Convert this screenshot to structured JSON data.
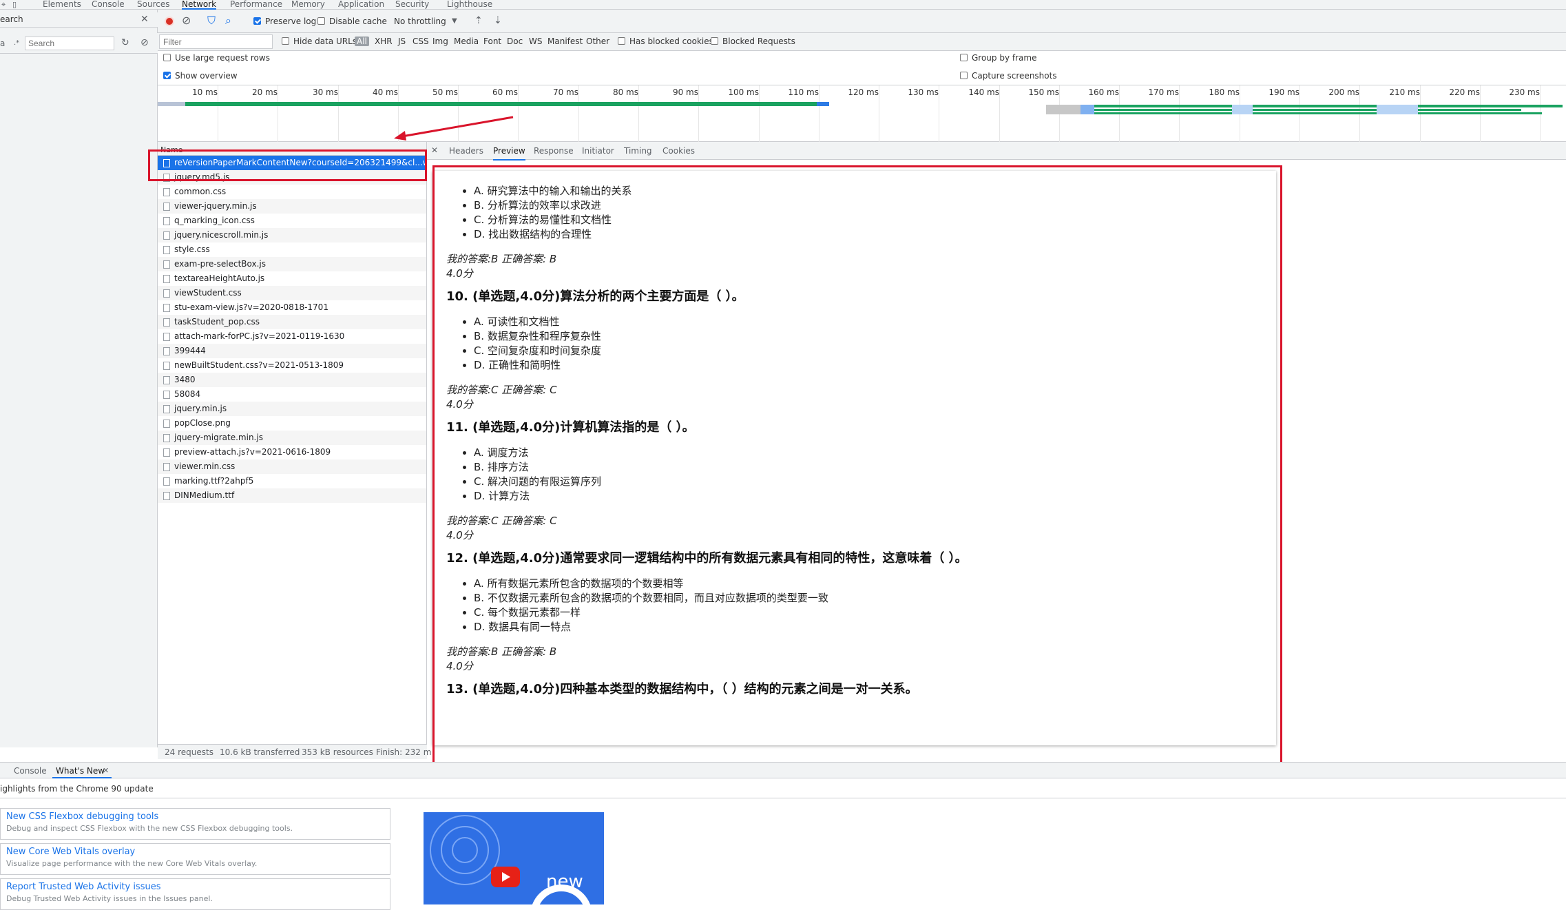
{
  "devtools_tabs": [
    "Elements",
    "Console",
    "Sources",
    "Network",
    "Performance",
    "Memory",
    "Application",
    "Security",
    "Lighthouse"
  ],
  "active_tab": "Network",
  "left_panel": {
    "search_label": "earch",
    "search_placeholder": "Search",
    "row2_prefix": "a"
  },
  "toolbar": {
    "preserve_log": "Preserve log",
    "disable_cache": "Disable cache",
    "throttling": "No throttling"
  },
  "filterbar": {
    "placeholder": "Filter",
    "hide_data_urls": "Hide data URLs",
    "types": [
      "All",
      "XHR",
      "JS",
      "CSS",
      "Img",
      "Media",
      "Font",
      "Doc",
      "WS",
      "Manifest",
      "Other"
    ],
    "has_blocked_cookies": "Has blocked cookies",
    "blocked_requests": "Blocked Requests"
  },
  "settings": {
    "large_rows": "Use large request rows",
    "show_overview": "Show overview",
    "group_by_frame": "Group by frame",
    "capture_screenshots": "Capture screenshots"
  },
  "timeline_ticks": [
    "10 ms",
    "20 ms",
    "30 ms",
    "40 ms",
    "50 ms",
    "60 ms",
    "70 ms",
    "80 ms",
    "90 ms",
    "100 ms",
    "110 ms",
    "120 ms",
    "130 ms",
    "140 ms",
    "150 ms",
    "160 ms",
    "170 ms",
    "180 ms",
    "190 ms",
    "200 ms",
    "210 ms",
    "220 ms",
    "230 ms"
  ],
  "requests": {
    "header": "Name",
    "items": [
      "reVersionPaperMarkContentNew?courseId=206321499&cl...wMoo...",
      "jquery.md5.js",
      "common.css",
      "viewer-jquery.min.js",
      "q_marking_icon.css",
      "jquery.nicescroll.min.js",
      "style.css",
      "exam-pre-selectBox.js",
      "textareaHeightAuto.js",
      "viewStudent.css",
      "stu-exam-view.js?v=2020-0818-1701",
      "taskStudent_pop.css",
      "attach-mark-forPC.js?v=2021-0119-1630",
      "399444",
      "newBuiltStudent.css?v=2021-0513-1809",
      "3480",
      "58084",
      "jquery.min.js",
      "popClose.png",
      "jquery-migrate.min.js",
      "preview-attach.js?v=2021-0616-1809",
      "viewer.min.css",
      "marking.ttf?2ahpf5",
      "DINMedium.ttf"
    ]
  },
  "status": {
    "requests": "24 requests",
    "transferred": "10.6 kB transferred",
    "resources": "353 kB resources",
    "finish": "Finish: 232 m"
  },
  "detail_tabs": [
    "Headers",
    "Preview",
    "Response",
    "Initiator",
    "Timing",
    "Cookies"
  ],
  "active_detail_tab": "Preview",
  "preview": {
    "q9_options": [
      "A. 研究算法中的输入和输出的关系",
      "B. 分析算法的效率以求改进",
      "C. 分析算法的易懂性和文档性",
      "D. 找出数据结构的合理性"
    ],
    "q9_answer": "我的答案:B  正确答案: B",
    "q9_score": "4.0分",
    "q10_title": "10. (单选题,4.0分)算法分析的两个主要方面是（ ）。",
    "q10_options": [
      "A. 可读性和文档性",
      "B. 数据复杂性和程序复杂性",
      "C. 空间复杂度和时间复杂度",
      "D. 正确性和简明性"
    ],
    "q10_answer": "我的答案:C  正确答案: C",
    "q10_score": "4.0分",
    "q11_title": "11. (单选题,4.0分)计算机算法指的是（ ）。",
    "q11_options": [
      "A. 调度方法",
      "B. 排序方法",
      "C. 解决问题的有限运算序列",
      "D. 计算方法"
    ],
    "q11_answer": "我的答案:C  正确答案: C",
    "q11_score": "4.0分",
    "q12_title": "12. (单选题,4.0分)通常要求同一逻辑结构中的所有数据元素具有相同的特性，这意味着（ ）。",
    "q12_options": [
      "A. 所有数据元素所包含的数据项的个数要相等",
      "B. 不仅数据元素所包含的数据项的个数要相同，而且对应数据项的类型要一致",
      "C. 每个数据元素都一样",
      "D. 数据具有同一特点"
    ],
    "q12_answer": "我的答案:B  正确答案: B",
    "q12_score": "4.0分",
    "q13_title": "13. (单选题,4.0分)四种基本类型的数据结构中，（ ）结构的元素之间是一对一关系。"
  },
  "drawer": {
    "tabs": [
      "Console",
      "What's New"
    ],
    "highlights": "ighlights from the Chrome 90 update",
    "cards": [
      {
        "title": "New CSS Flexbox debugging tools",
        "desc": "Debug and inspect CSS Flexbox with the new CSS Flexbox debugging tools."
      },
      {
        "title": "New Core Web Vitals overlay",
        "desc": "Visualize page performance with the new Core Web Vitals overlay."
      },
      {
        "title": "Report Trusted Web Activity issues",
        "desc": "Debug Trusted Web Activity issues in the Issues panel."
      }
    ],
    "video_label": "new"
  },
  "colors": {
    "accent": "#1a73e8",
    "annotation_red": "#d9142b",
    "waterfall_green": "#1aa260",
    "waterfall_blue": "#2d7be5"
  }
}
